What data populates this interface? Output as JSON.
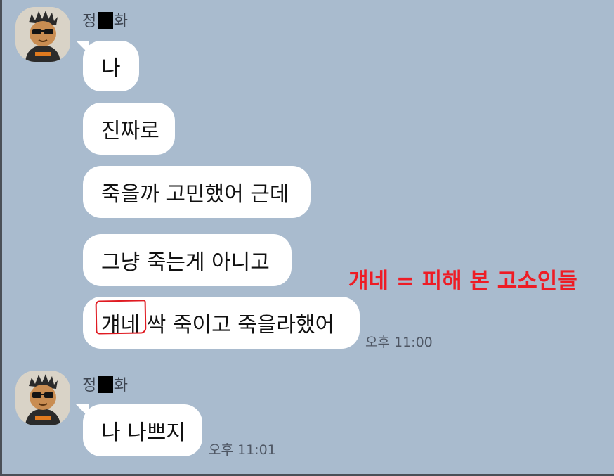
{
  "chat": {
    "groups": [
      {
        "sender": {
          "prefix": "정",
          "suffix": "화"
        },
        "messages": [
          "나",
          "진짜로",
          "죽을까 고민했어 근데",
          "그냥 죽는게 아니고"
        ],
        "last_message": {
          "circled_word": "걔네",
          "rest": " 싹 죽이고 죽을라했어"
        },
        "time": "오후 11:00"
      },
      {
        "sender": {
          "prefix": "정",
          "suffix": "화"
        },
        "messages": [
          "나 나쁘지"
        ],
        "time": "오후 11:01"
      }
    ]
  },
  "annotation": {
    "text": "걔네 = 피해 본 고소인들",
    "color": "#ee1c25"
  },
  "colors": {
    "background": "#a9bbce",
    "bubble": "#ffffff"
  }
}
